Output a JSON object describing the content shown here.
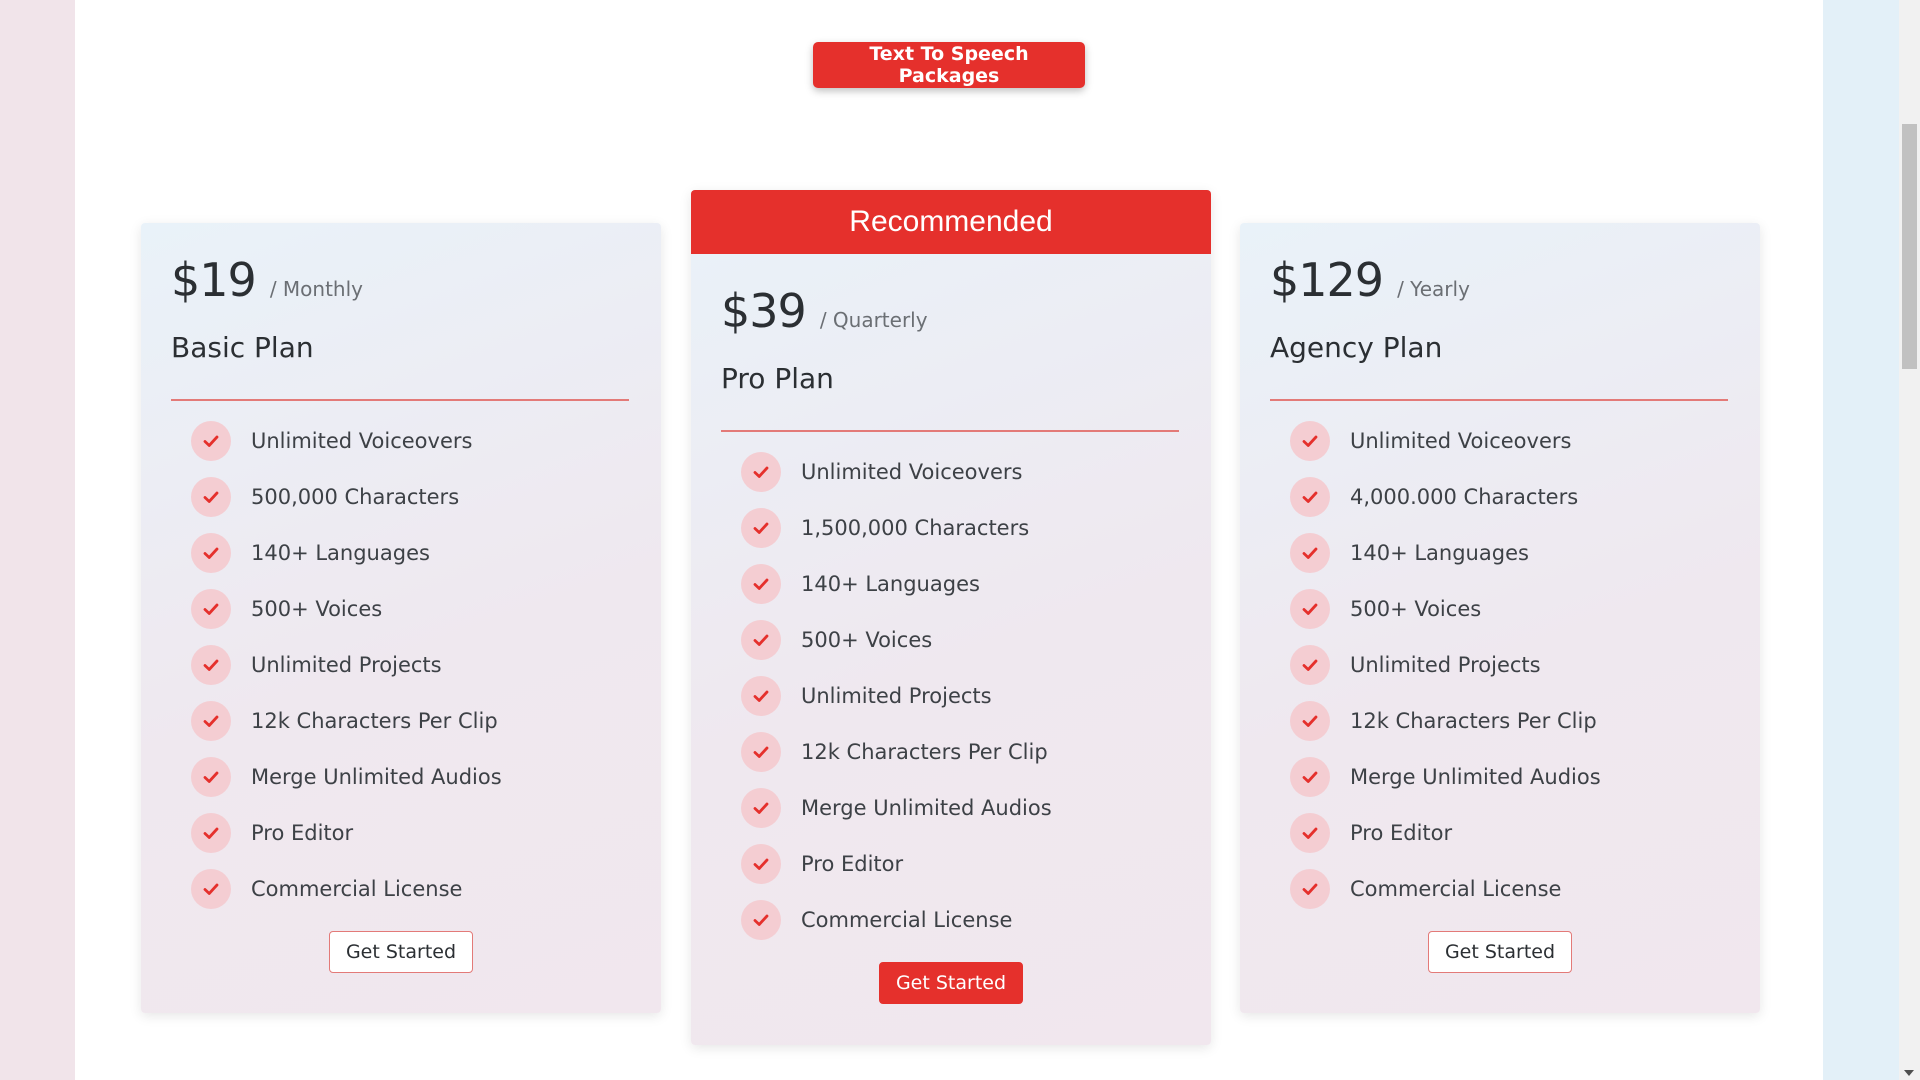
{
  "header": {
    "packages_button_label": "Text To Speech Packages"
  },
  "colors": {
    "accent": "#e5302c",
    "divider": "#e37a78",
    "check_bg": "#f4cdd2"
  },
  "plans": [
    {
      "price": "$19",
      "period": "/ Monthly",
      "name": "Basic Plan",
      "features": [
        "Unlimited Voiceovers",
        "500,000 Characters",
        "140+ Languages",
        "500+ Voices",
        "Unlimited Projects",
        "12k Characters Per Clip",
        "Merge Unlimited Audios",
        "Pro Editor",
        "Commercial License"
      ],
      "cta_label": "Get Started"
    },
    {
      "ribbon": "Recommended",
      "price": "$39",
      "period": "/ Quarterly",
      "name": "Pro Plan",
      "features": [
        "Unlimited Voiceovers",
        "1,500,000 Characters",
        "140+ Languages",
        "500+ Voices",
        "Unlimited Projects",
        "12k Characters Per Clip",
        "Merge Unlimited Audios",
        "Pro Editor",
        "Commercial License"
      ],
      "cta_label": "Get Started"
    },
    {
      "price": "$129",
      "period": "/ Yearly",
      "name": "Agency Plan",
      "features": [
        "Unlimited Voiceovers",
        "4,000.000 Characters",
        "140+ Languages",
        "500+ Voices",
        "Unlimited Projects",
        "12k Characters Per Clip",
        "Merge Unlimited Audios",
        "Pro Editor",
        "Commercial License"
      ],
      "cta_label": "Get Started"
    }
  ],
  "icons": {
    "feature_check": "check-icon",
    "scroll_down": "chevron-down-icon"
  }
}
